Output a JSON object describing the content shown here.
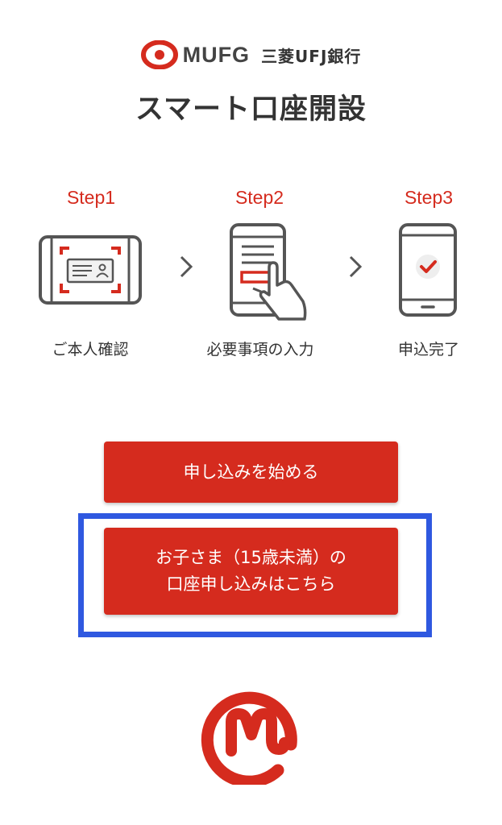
{
  "brand": {
    "logo_text": "MUFG",
    "bank_name": "三菱UFJ銀行"
  },
  "page": {
    "title": "スマート口座開設"
  },
  "steps": [
    {
      "label": "Step1",
      "caption": "ご本人確認"
    },
    {
      "label": "Step2",
      "caption": "必要事項の入力"
    },
    {
      "label": "Step3",
      "caption": "申込完了"
    }
  ],
  "actions": {
    "start_label": "申し込みを始める",
    "kids_line1": "お子さま（15歳未満）の",
    "kids_line2": "口座申し込みはこちら"
  },
  "colors": {
    "brand_red": "#d52b1e",
    "highlight_blue": "#2f58e0",
    "text_dark": "#333333"
  },
  "icons": {
    "step1": "id-card-scan-phone-icon",
    "step2": "phone-form-tap-icon",
    "step3": "phone-check-icon",
    "separator": "chevron-right-icon",
    "footer": "mufg-m-logo-icon"
  }
}
